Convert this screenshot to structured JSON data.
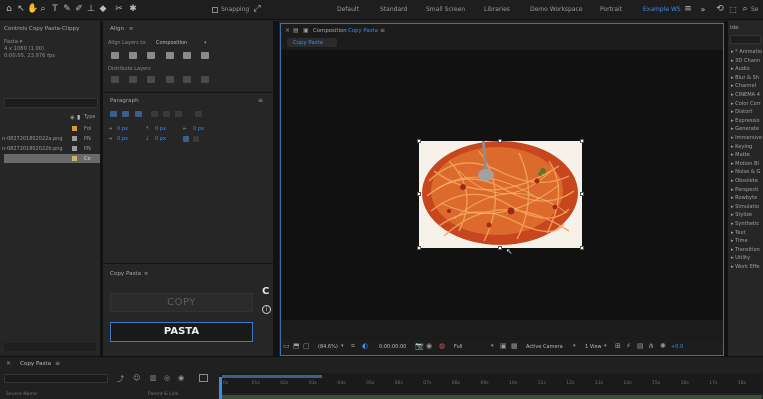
{
  "toolbar": {
    "snapping_label": "Snapping",
    "workspaces": [
      "Default",
      "Standard",
      "Small Screen",
      "Libraries",
      "Demo Workspace",
      "Portrait",
      "Example WS"
    ],
    "active_workspace": "Example WS",
    "search_label": "Se"
  },
  "project": {
    "tab_title": "Controls Copy Pasta-Clippy",
    "item_name": "Pasta ▾",
    "item_size": "4 x 1080 (1.00)",
    "item_duration": "0:00:05, 23.976 fps",
    "column_type": "Type",
    "rows": [
      {
        "name": "",
        "type": "Fol"
      },
      {
        "name": "n-0827201802022a.png",
        "type": "PN"
      },
      {
        "name": "n-0827201802022b.png",
        "type": "PN"
      },
      {
        "name": "",
        "type": "Co"
      }
    ]
  },
  "align": {
    "tab_title": "Align",
    "align_to_label": "Align Layers to:",
    "align_to_value": "Composition",
    "distribute_label": "Distribute Layers"
  },
  "paragraph": {
    "tab_title": "Paragraph",
    "indent_left": "0 px",
    "indent_first": "0 px",
    "indent_right": "0 px",
    "space_before": "0 px",
    "space_after": "0 px"
  },
  "copypasta": {
    "tab_title": "Copy Pasta",
    "copy_label": "COPY",
    "pasta_label": "PASTA",
    "side_logo": "C"
  },
  "composition": {
    "tab_title": "Composition",
    "comp_name": "Copy Pasta",
    "breadcrumb": "Copy Pasta",
    "zoom": "(84.6%)",
    "timecode": "0:00:00:00",
    "resolution": "Full",
    "camera": "Active Camera",
    "views": "1 View",
    "exposure": "+0.0"
  },
  "effects": {
    "tab_title": "ide",
    "items": [
      "* Animatio",
      "3D Chann",
      "Audio",
      "Blur & Sh",
      "Channel",
      "CINEMA 4",
      "Color Corr",
      "Distort",
      "Expressio",
      "Generate",
      "Immersive",
      "Keying",
      "Matte",
      "Motion Bl",
      "Noise & G",
      "Obsolete",
      "Perspecti",
      "Rowbyte",
      "Simulatio",
      "Stylize",
      "Synthetic",
      "Text",
      "Time",
      "Transition",
      "Utility",
      "Work Effe"
    ]
  },
  "timeline": {
    "tab_title": "Copy Pasta",
    "source_name_label": "Source Name",
    "parent_link_label": "Parent & Link",
    "ticks": [
      "0s",
      "01s",
      "02s",
      "03s",
      "04s",
      "05s",
      "06s",
      "07s",
      "08s",
      "09s",
      "10s",
      "11s",
      "12s",
      "13s",
      "14s",
      "15s",
      "16s",
      "17s",
      "18s"
    ]
  },
  "colors": {
    "accent_blue": "#3b8ce6",
    "panel_bg": "#262626",
    "viewer_bg": "#111111",
    "comp_border": "#3a6fb0"
  }
}
